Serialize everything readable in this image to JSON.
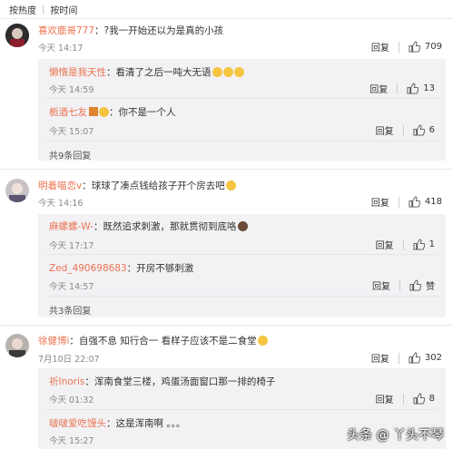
{
  "sort_tabs": {
    "hot": "按热度",
    "time": "按时间"
  },
  "comments": [
    {
      "user": "喜欢鹿哥777",
      "text": "：?我一开始还以为是真的小孩",
      "time": "今天 14:17",
      "reply_label": "回复",
      "likes": "709",
      "replies": [
        {
          "user": "懒惰是我天性",
          "text": "：看清了之后一吨大无语",
          "time": "今天 14:59",
          "reply_label": "回复",
          "likes": "13"
        },
        {
          "user": "栀酒七友",
          "text": "：你不是一个人",
          "time": "今天 15:07",
          "reply_label": "回复",
          "likes": "6"
        }
      ],
      "more_replies": "共9条回复"
    },
    {
      "user": "明着喵恋v",
      "text": "：球球了凑点钱给孩子开个房去吧",
      "time": "今天 14:16",
      "reply_label": "回复",
      "likes": "418",
      "replies": [
        {
          "user": "麻螺螺-W-",
          "text": "：既然追求刺激，那就贯彻到底咯",
          "time": "今天 17:17",
          "reply_label": "回复",
          "likes": "1"
        },
        {
          "user": "Zed_490698683",
          "text": "：开房不够刺激",
          "time": "今天 14:57",
          "reply_label": "回复",
          "likes": "赞"
        }
      ],
      "more_replies": "共3条回复"
    },
    {
      "user": "徐健博i",
      "text": "：自强不息 知行合一 看样子应该不是二食堂",
      "time": "7月10日 22:07",
      "reply_label": "回复",
      "likes": "302",
      "replies": [
        {
          "user": "祈Inoris",
          "text": "：浑南食堂三楼，鸡蛋汤面窗口那一排的椅子",
          "time": "今天 01:32",
          "reply_label": "回复",
          "likes": "8"
        },
        {
          "user": "啵啵爱吃馒头",
          "text": "：这是浑南啊 。。。",
          "time": "今天 15:27",
          "reply_label": "",
          "likes": ""
        }
      ]
    }
  ],
  "watermark": "头条 @ 丫头不琴",
  "colors": {
    "username": "#eb7350",
    "sub_bg": "#f2f2f5"
  },
  "icons": {
    "like": "thumbs-up-icon",
    "emoji": "emoji-icon"
  }
}
